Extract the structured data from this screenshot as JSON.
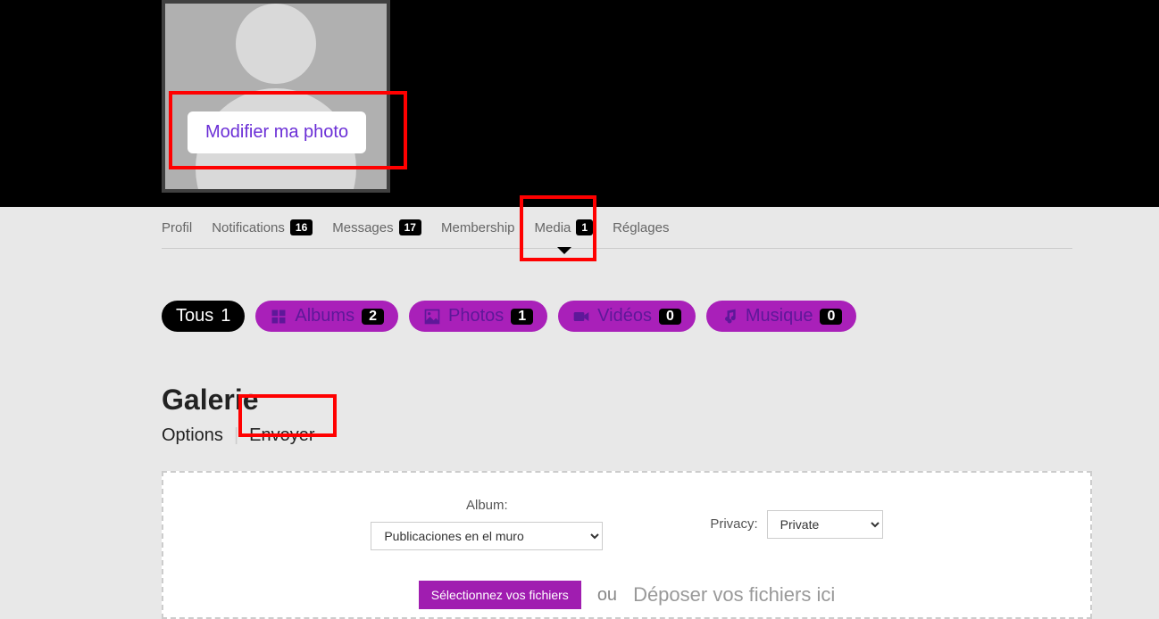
{
  "header": {
    "edit_photo_label": "Modifier ma photo"
  },
  "nav": {
    "items": [
      {
        "label": "Profil",
        "count": null
      },
      {
        "label": "Notifications",
        "count": "16"
      },
      {
        "label": "Messages",
        "count": "17"
      },
      {
        "label": "Membership",
        "count": null
      },
      {
        "label": "Media",
        "count": "1"
      },
      {
        "label": "Réglages",
        "count": null
      }
    ]
  },
  "filters": {
    "all": {
      "label": "Tous",
      "count": "1"
    },
    "albums": {
      "label": "Albums",
      "count": "2"
    },
    "photos": {
      "label": "Photos",
      "count": "1"
    },
    "videos": {
      "label": "Vidéos",
      "count": "0"
    },
    "music": {
      "label": "Musique",
      "count": "0"
    }
  },
  "gallery": {
    "title": "Galerie",
    "subtabs": {
      "options": "Options",
      "send": "Envoyer"
    }
  },
  "form": {
    "album_label": "Album:",
    "album_value": "Publicaciones en el muro",
    "privacy_label": "Privacy:",
    "privacy_value": "Private",
    "select_files": "Sélectionnez vos fichiers",
    "ou": "ou",
    "drop_text": "Déposer vos fichiers ici"
  }
}
